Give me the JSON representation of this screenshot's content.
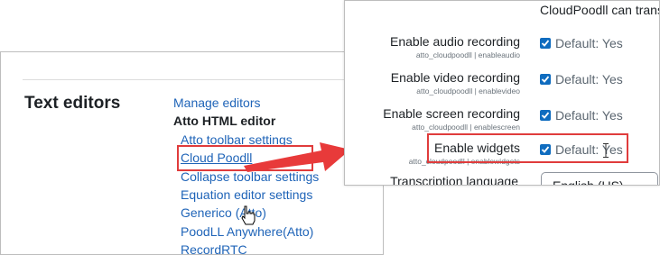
{
  "left_panel": {
    "section_title": "Text editors",
    "nav": {
      "manage_editors": "Manage editors",
      "atto_editor": "Atto HTML editor",
      "items": [
        "Atto toolbar settings",
        "Cloud Poodll",
        "Collapse toolbar settings",
        "Equation editor settings",
        "Generico (Atto)",
        "PoodLL Anywhere(Atto)",
        "RecordRTC"
      ]
    }
  },
  "right_panel": {
    "top_note": "CloudPoodll can trans",
    "rows": [
      {
        "label": "Enable audio recording",
        "setting": "atto_cloudpoodll | enableaudio",
        "default": "Default: Yes",
        "checked": true
      },
      {
        "label": "Enable video recording",
        "setting": "atto_cloudpoodll | enablevideo",
        "default": "Default: Yes",
        "checked": true
      },
      {
        "label": "Enable screen recording",
        "setting": "atto_cloudpoodll | enablescreen",
        "default": "Default: Yes",
        "checked": true
      },
      {
        "label": "Enable widgets",
        "setting": "atto_cloudpoodll | enablewidgets",
        "default": "Default: Yes",
        "checked": true
      }
    ],
    "transcription_label": "Transcription language",
    "transcription_value": "English (US)"
  },
  "colors": {
    "link": "#1f64b8",
    "highlight": "#e03c3c",
    "checkbox": "#0f6cbf"
  }
}
